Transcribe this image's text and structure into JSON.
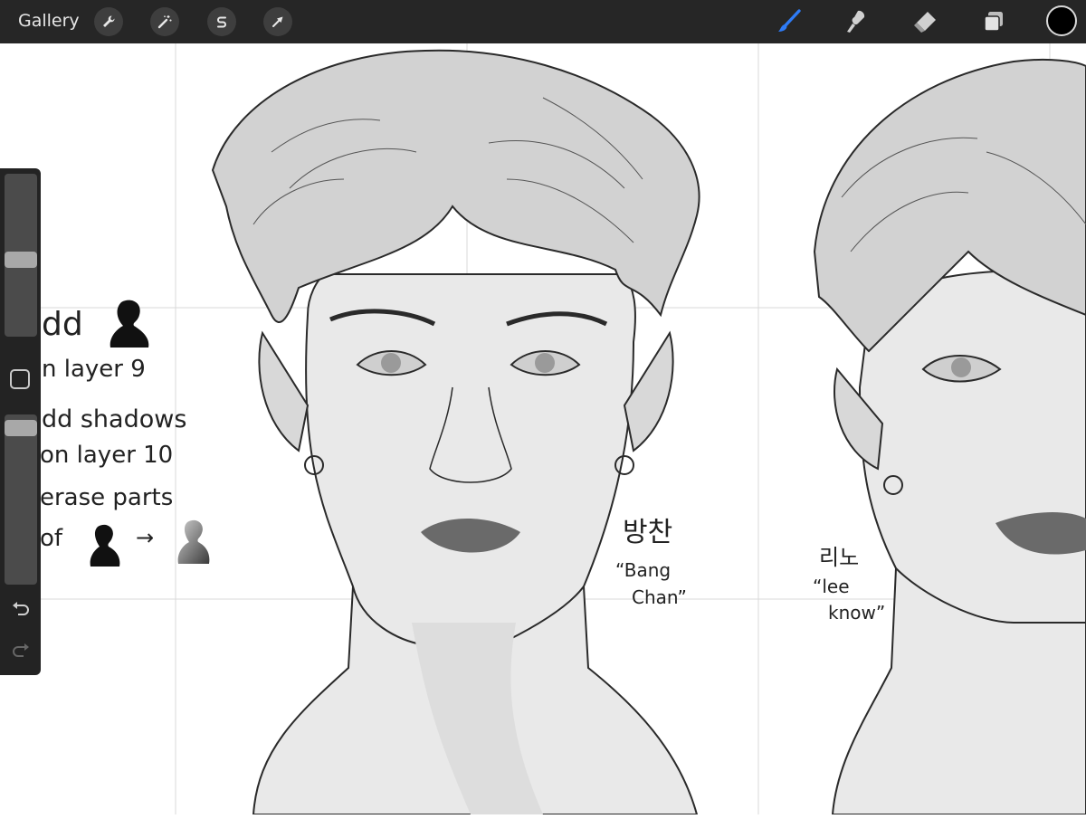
{
  "app": {
    "gallery_label": "Gallery",
    "accent_color": "#2e7bf6",
    "current_color": "#000000"
  },
  "toolbar": {
    "left_tools": [
      "wrench-icon",
      "magic-wand-icon",
      "selection-s-icon",
      "transform-arrow-icon"
    ],
    "right_tools": [
      "brush-icon",
      "smudge-icon",
      "eraser-icon",
      "layers-icon",
      "color-well"
    ],
    "active_tool": "brush"
  },
  "sidebar": {
    "brush_size_level": 0.52,
    "opacity_level": 0.97
  },
  "notes": {
    "line1": "dd",
    "line2": "n layer 9",
    "line3": "dd shadows",
    "line4": "on layer 10",
    "line5": "erase parts",
    "line6": "of",
    "arrow": "→"
  },
  "labels": {
    "bangchan_korean": "방찬",
    "bangchan_quote_open": "“Bang",
    "bangchan_quote_close": "Chan”",
    "leeknow_korean": "리노",
    "leeknow_quote_open": "“lee",
    "leeknow_quote_close": "know”"
  }
}
